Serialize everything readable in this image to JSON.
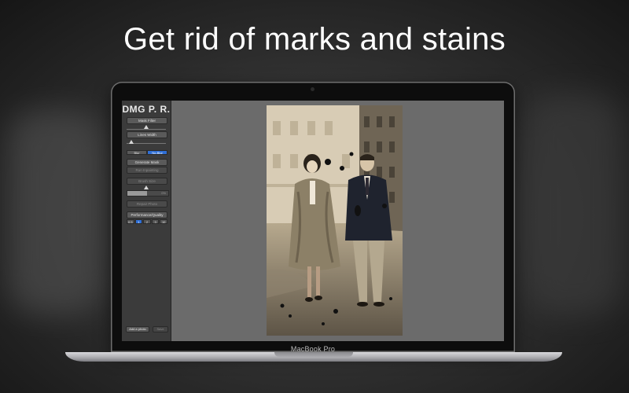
{
  "headline": "Get rid of marks and stains",
  "device": {
    "label": "MacBook Pro"
  },
  "app": {
    "title": "DMG P. R.",
    "mask_filter": "Mask Filter",
    "lines_width": "Lines Width",
    "blur_options": [
      "Blur",
      "No-Blur"
    ],
    "generate_mask": "Generate Mask",
    "run_inpaint": "Run Inpainting",
    "brush_size": "Brush Size",
    "progress_tag": "0%",
    "repair_photo": "Repair Photo",
    "performance_quality": "Performance/Quality",
    "perf_options": [
      "0.5",
      "1",
      "2",
      "3",
      "10"
    ],
    "add_photo": "Add a photo",
    "save": "Save"
  },
  "colors": {
    "accent": "#2f6fd6"
  }
}
